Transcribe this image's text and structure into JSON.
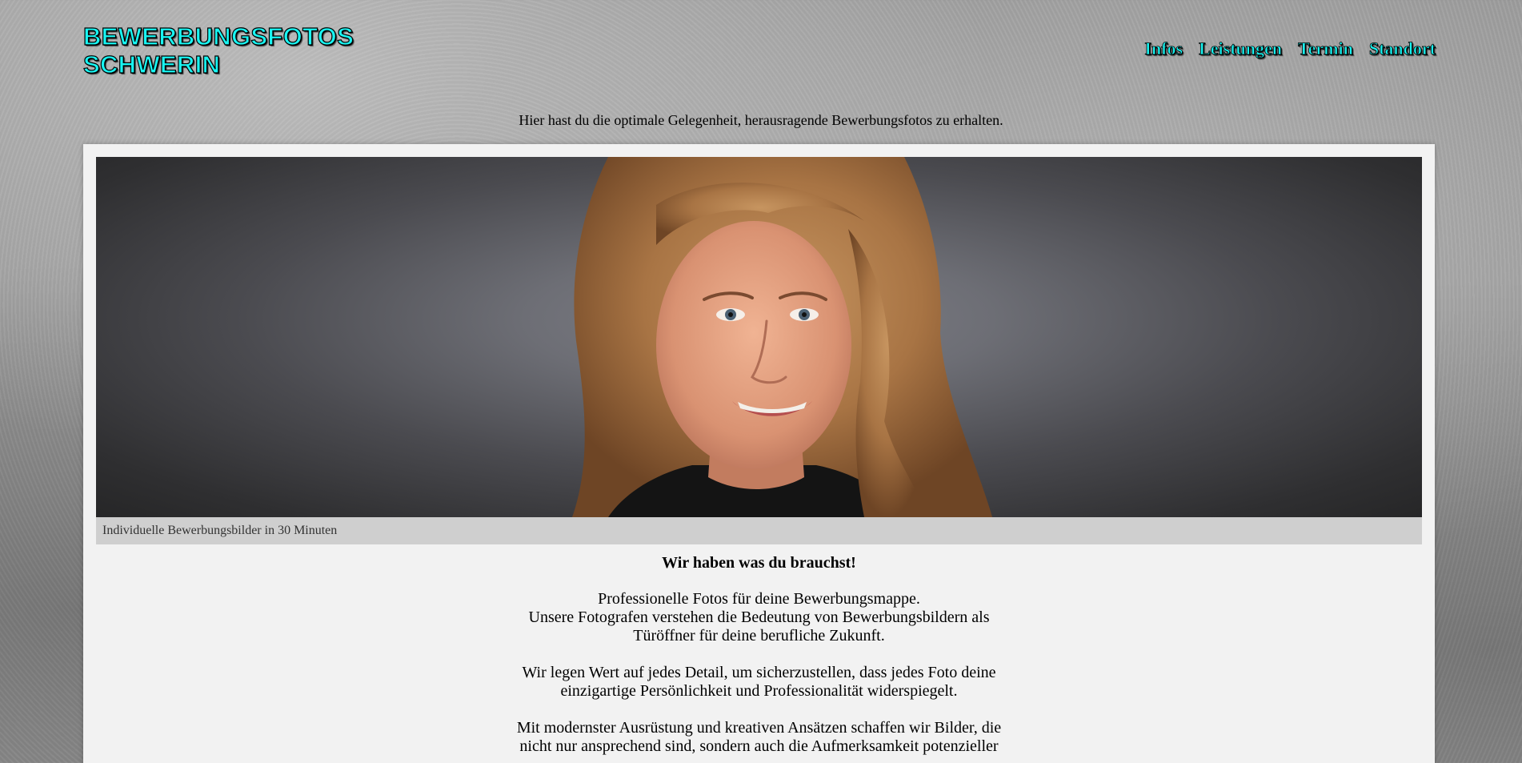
{
  "header": {
    "title_line1": "BEWERBUNGSFOTOS",
    "title_line2": "SCHWERIN"
  },
  "nav": {
    "items": [
      {
        "label": "Infos"
      },
      {
        "label": "Leistungen"
      },
      {
        "label": "Termin"
      },
      {
        "label": "Standort"
      }
    ]
  },
  "tagline": "Hier hast du die optimale Gelegenheit, herausragende Bewerbungsfotos zu erhalten.",
  "hero": {
    "caption": "Individuelle Bewerbungsbilder in 30 Minuten"
  },
  "main": {
    "heading": "Wir haben was du brauchst!",
    "paragraph1": {
      "line1": "Professionelle Fotos für deine Bewerbungsmappe.",
      "line2": "Unsere Fotografen verstehen die Bedeutung von Bewerbungsbildern als Türöffner für deine berufliche Zukunft."
    },
    "paragraph2": "Wir legen Wert auf jedes Detail, um sicherzustellen, dass jedes Foto deine einzigartige Persönlichkeit und Professionalität widerspiegelt.",
    "paragraph3": "Mit modernster Ausrüstung und kreativen Ansätzen schaffen wir Bilder, die nicht nur ansprechend sind, sondern auch die Aufmerksamkeit potenzieller"
  },
  "colors": {
    "accent": "#18f5f2",
    "panel_bg": "#f2f2f2",
    "caption_bg": "#cfcfcf"
  }
}
